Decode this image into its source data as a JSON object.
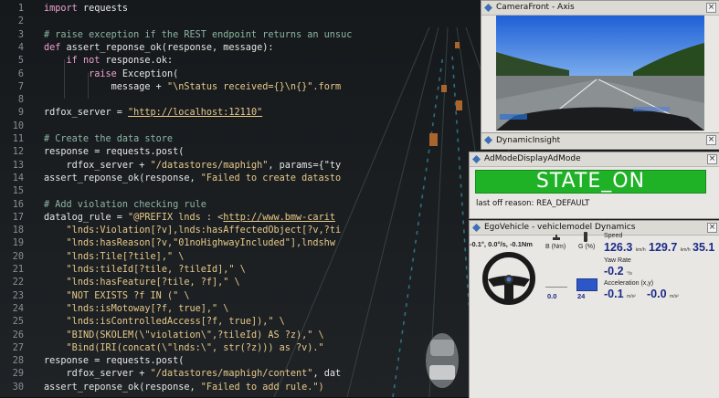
{
  "editor": {
    "lines": [
      {
        "n": "1",
        "indent": 0,
        "parts": [
          [
            "kw",
            "import"
          ],
          [
            "tx",
            " requests"
          ]
        ]
      },
      {
        "n": "2",
        "indent": 0,
        "parts": []
      },
      {
        "n": "3",
        "indent": 0,
        "parts": [
          [
            "cm",
            "# raise exception if the REST endpoint returns an unsuc"
          ]
        ]
      },
      {
        "n": "4",
        "indent": 0,
        "parts": [
          [
            "kw",
            "def"
          ],
          [
            "tx",
            " assert_reponse_ok(response, message):"
          ]
        ]
      },
      {
        "n": "5",
        "indent": 1,
        "parts": [
          [
            "kw",
            "if not"
          ],
          [
            "tx",
            " response.ok:"
          ]
        ]
      },
      {
        "n": "6",
        "indent": 2,
        "parts": [
          [
            "kw",
            "raise"
          ],
          [
            "tx",
            " Exception("
          ]
        ]
      },
      {
        "n": "7",
        "indent": 3,
        "parts": [
          [
            "tx",
            "message + "
          ],
          [
            "st",
            "\"\\nStatus received={}\\n{}\".form"
          ]
        ]
      },
      {
        "n": "8",
        "indent": 0,
        "parts": []
      },
      {
        "n": "9",
        "indent": 0,
        "parts": [
          [
            "tx",
            "rdfox_server = "
          ],
          [
            "url",
            "\"http://localhost:12110\""
          ]
        ]
      },
      {
        "n": "10",
        "indent": 0,
        "parts": []
      },
      {
        "n": "11",
        "indent": 0,
        "parts": [
          [
            "cm",
            "# Create the data store"
          ]
        ]
      },
      {
        "n": "12",
        "indent": 0,
        "parts": [
          [
            "tx",
            "response = requests.post("
          ]
        ]
      },
      {
        "n": "13",
        "indent": 1,
        "parts": [
          [
            "tx",
            "rdfox_server + "
          ],
          [
            "st",
            "\"/datastores/maphigh\""
          ],
          [
            "tx",
            ", params={\"ty"
          ]
        ]
      },
      {
        "n": "14",
        "indent": 0,
        "parts": [
          [
            "tx",
            "assert_reponse_ok(response, "
          ],
          [
            "st",
            "\"Failed to create datasto"
          ]
        ]
      },
      {
        "n": "15",
        "indent": 0,
        "parts": []
      },
      {
        "n": "16",
        "indent": 0,
        "parts": [
          [
            "cm",
            "# Add violation checking rule"
          ]
        ]
      },
      {
        "n": "17",
        "indent": 0,
        "parts": [
          [
            "tx",
            "datalog_rule = "
          ],
          [
            "st",
            "\"@PREFIX lnds : <"
          ],
          [
            "url",
            "http://www.bmw-carit"
          ]
        ]
      },
      {
        "n": "18",
        "indent": 1,
        "parts": [
          [
            "st",
            "\"lnds:Violation[?v],lnds:hasAffectedObject[?v,?ti"
          ]
        ]
      },
      {
        "n": "19",
        "indent": 1,
        "parts": [
          [
            "st",
            "\"lnds:hasReason[?v,\"01noHighwayIncluded\"],lndshw"
          ]
        ]
      },
      {
        "n": "20",
        "indent": 1,
        "parts": [
          [
            "st",
            "\"lnds:Tile[?tile],\" \\"
          ]
        ]
      },
      {
        "n": "21",
        "indent": 1,
        "parts": [
          [
            "st",
            "\"lnds:tileId[?tile, ?tileId],\" \\"
          ]
        ]
      },
      {
        "n": "22",
        "indent": 1,
        "parts": [
          [
            "st",
            "\"lnds:hasFeature[?tile, ?f],\" \\"
          ]
        ]
      },
      {
        "n": "23",
        "indent": 1,
        "parts": [
          [
            "st",
            "\"NOT EXISTS ?f IN (\" \\"
          ]
        ]
      },
      {
        "n": "24",
        "indent": 1,
        "parts": [
          [
            "st",
            "\"lnds:isMotoway[?f, true],\" \\"
          ]
        ]
      },
      {
        "n": "25",
        "indent": 1,
        "parts": [
          [
            "st",
            "\"lnds:isControlledAccess[?f, true]),\" \\"
          ]
        ]
      },
      {
        "n": "26",
        "indent": 1,
        "parts": [
          [
            "st",
            "\"BIND(SKOLEM(\\\"violation\\\",?tileId) AS ?z),\" \\"
          ]
        ]
      },
      {
        "n": "27",
        "indent": 1,
        "parts": [
          [
            "st",
            "\"Bind(IRI(concat(\\\"lnds:\\\", str(?z))) as ?v).\""
          ]
        ]
      },
      {
        "n": "28",
        "indent": 0,
        "parts": [
          [
            "tx",
            "response = requests.post("
          ]
        ]
      },
      {
        "n": "29",
        "indent": 1,
        "parts": [
          [
            "tx",
            "rdfox_server + "
          ],
          [
            "st",
            "\"/datastores/maphigh/content\""
          ],
          [
            "tx",
            ", dat"
          ]
        ]
      },
      {
        "n": "30",
        "indent": 0,
        "parts": [
          [
            "tx",
            "assert_reponse_ok(response, "
          ],
          [
            "st",
            "\"Failed to add rule.\")"
          ]
        ]
      }
    ]
  },
  "camera": {
    "title": "CameraFront - Axis"
  },
  "insight": {
    "title": "DynamicInsight"
  },
  "admode": {
    "title": "AdModeDisplayAdMode",
    "state": "STATE_ON",
    "last_off": "last off reason: REA_DEFAULT",
    "state_color": "#1fb227"
  },
  "ego": {
    "title": "EgoVehicle - vehiclemodel Dynamics",
    "steering_readout": "-0.1°, 0.0°/s, -0.1Nm",
    "brake_label": "B (Nm)",
    "gas_label": "G (%)",
    "brake_value": "0.0",
    "gas_value": "24",
    "speed_label": "Speed",
    "speed_values": [
      "126.3",
      "129.7",
      "35.1"
    ],
    "speed_unit": "km/h",
    "yaw_label": "Yaw Rate",
    "yaw_value": "-0.2",
    "yaw_unit": "°/s",
    "accel_label": "Acceleration (x,y)",
    "accel_x": "-0.1",
    "accel_y": "-0.0",
    "accel_unit": "m/s²",
    "accel_fill_color": "#2b57c8"
  },
  "icons": [
    "panel-diamond-icon",
    "close-icon",
    "steering-wheel-icon",
    "brake-pedal-icon",
    "gas-pedal-icon"
  ]
}
